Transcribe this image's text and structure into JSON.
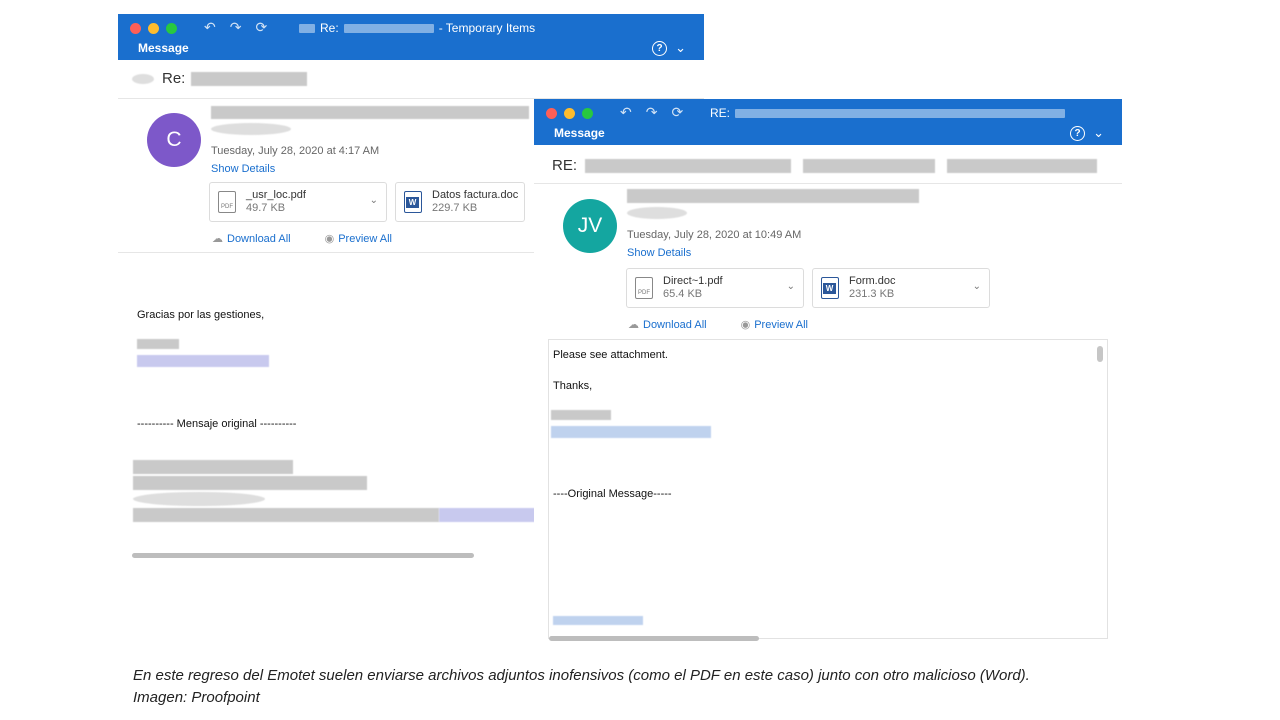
{
  "window1": {
    "title_prefix": "Re:",
    "title_suffix": "- Temporary Items",
    "tab": "Message",
    "subject_prefix": "Re:",
    "avatar_initial": "C",
    "date": "Tuesday, July 28, 2020 at 4:17 AM",
    "show_details": "Show Details",
    "attachments": [
      {
        "name": "_usr_loc.pdf",
        "size": "49.7 KB",
        "icon": "pdf-file-icon"
      },
      {
        "name": "Datos factura.doc",
        "size": "229.7 KB",
        "icon": "word-file-icon"
      }
    ],
    "download_all": "Download All",
    "preview_all": "Preview All",
    "greeting": "Gracias por las gestiones,",
    "original_message": "---------- Mensaje original ----------"
  },
  "window2": {
    "title_prefix": "RE:",
    "tab": "Message",
    "subject_prefix": "RE:",
    "avatar_initial": "JV",
    "date": "Tuesday, July 28, 2020 at 10:49 AM",
    "show_details": "Show Details",
    "attachments": [
      {
        "name": "Direct~1.pdf",
        "size": "65.4 KB",
        "icon": "pdf-file-icon"
      },
      {
        "name": "Form.doc",
        "size": "231.3 KB",
        "icon": "word-file-icon"
      }
    ],
    "download_all": "Download All",
    "preview_all": "Preview All",
    "line1": "Please see attachment.",
    "line2": "Thanks,",
    "original_message": "----Original Message-----"
  },
  "caption": {
    "line1": "En este regreso del Emotet suelen enviarse archivos adjuntos inofensivos (como el PDF en este caso) junto con otro malicioso (Word).",
    "line2": "Imagen: Proofpoint"
  },
  "colors": {
    "titlebar": "#1a6fce",
    "avatar_c": "#7d58c9",
    "avatar_jv": "#14a6a0",
    "link": "#1a6fce"
  }
}
